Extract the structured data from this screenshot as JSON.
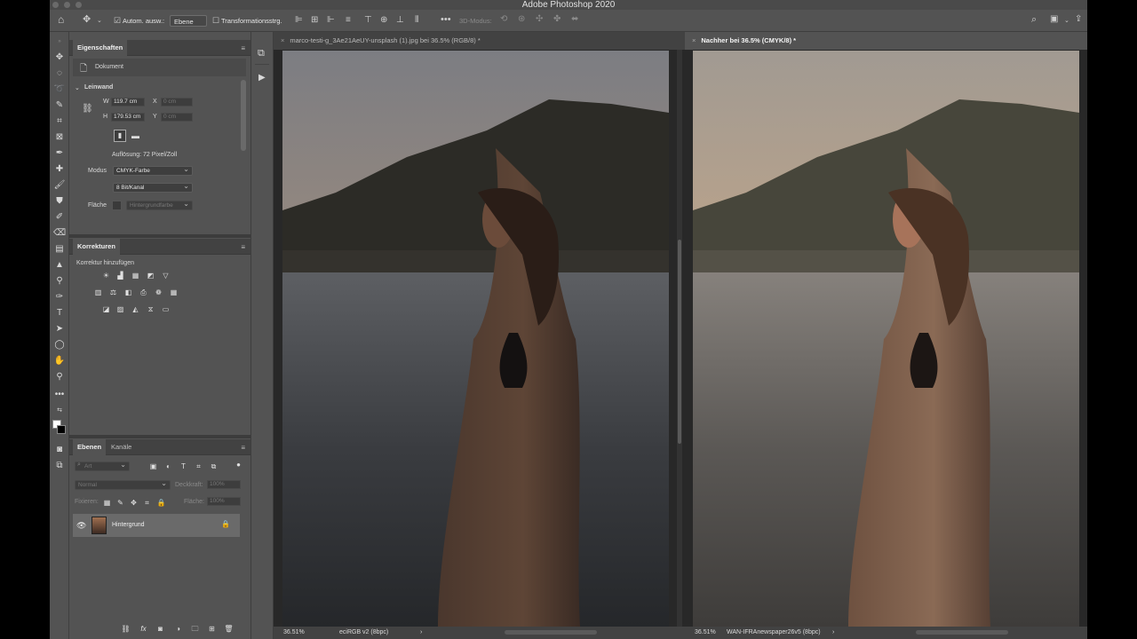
{
  "app": {
    "title": "Adobe Photoshop 2020"
  },
  "options_bar": {
    "auto_select_label": "Autom. ausw.:",
    "auto_select_value": "Ebene",
    "transform_label": "Transformationsstrg.",
    "mode_3d_label": "3D-Modus:"
  },
  "properties": {
    "tab": "Eigenschaften",
    "document_label": "Dokument",
    "canvas_section": "Leinwand",
    "w_label": "W",
    "w_value": "119.7 cm",
    "h_label": "H",
    "h_value": "179.53 cm",
    "x_label": "X",
    "x_placeholder": "0 cm",
    "y_label": "Y",
    "y_placeholder": "0 cm",
    "resolution": "Auflösung: 72 Pixel/Zoll",
    "mode_label": "Modus",
    "mode_value": "CMYK-Farbe",
    "bitdepth_value": "8 Bit/Kanal",
    "fill_label": "Fläche",
    "fill_value": "Hintergrundfarbe"
  },
  "adjustments": {
    "tab": "Korrekturen",
    "add_label": "Korrektur hinzufügen"
  },
  "layers": {
    "tab_layers": "Ebenen",
    "tab_channels": "Kanäle",
    "filter_placeholder": "Art",
    "blend_mode": "Normal",
    "opacity_label": "Deckkraft:",
    "opacity_value": "100%",
    "lock_label": "Fixieren:",
    "fill_label": "Fläche:",
    "fill_value": "100%",
    "items": [
      {
        "name": "Hintergrund"
      }
    ]
  },
  "documents": {
    "left_tab": "marco-testi-g_3Ae21AeUY-unsplash (1).jpg bei 36.5% (RGB/8) *",
    "right_tab": "Nachher bei 36.5% (CMYK/8) *",
    "left_zoom": "36.51%",
    "left_profile": "eciRGB v2 (8bpc)",
    "right_zoom": "36.51%",
    "right_profile": "WAN-IFRAnewspaper26v5 (8bpc)"
  },
  "colors": {
    "ui_panel": "#535353",
    "ui_dark": "#424242",
    "canvas_bg": "#282828"
  }
}
